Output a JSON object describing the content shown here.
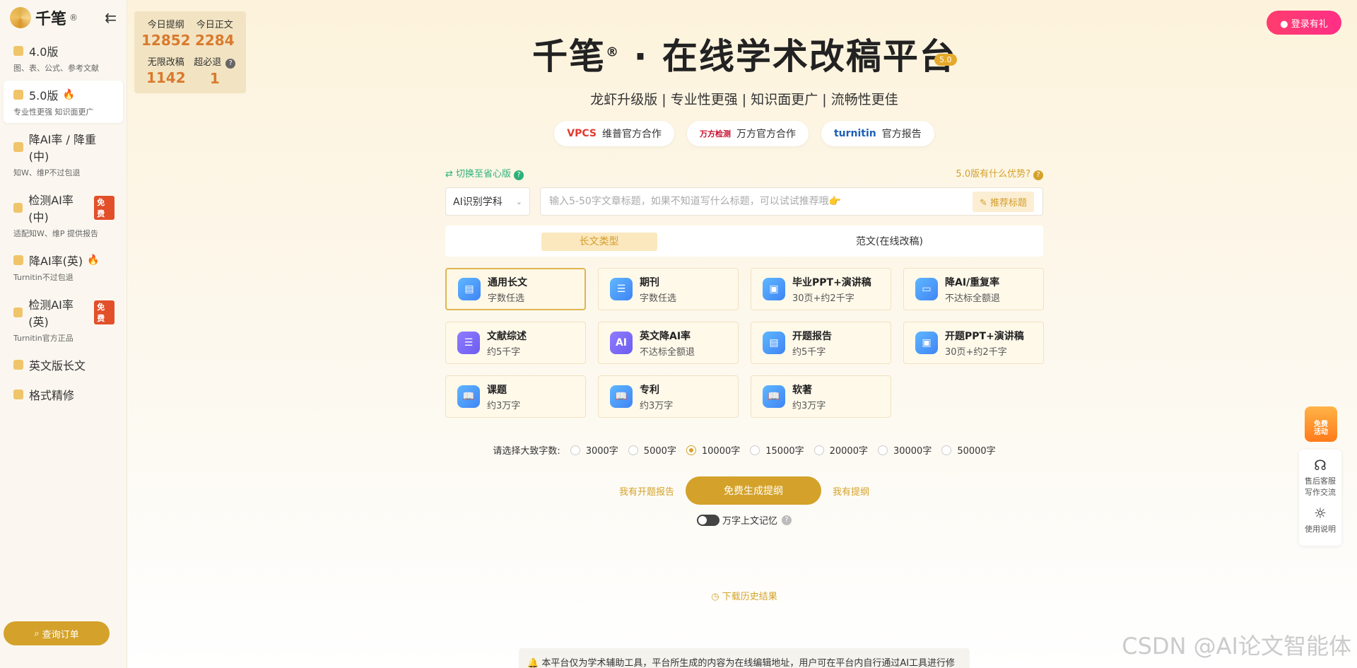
{
  "app": {
    "name": "千笔",
    "reg": "®"
  },
  "sidebar": {
    "items": [
      {
        "title": "4.0版",
        "sub": "图、表、公式、参考文献"
      },
      {
        "title": "5.0版",
        "sub": "专业性更强 知识面更广",
        "flame": "🔥"
      },
      {
        "title": "降AI率 / 降重(中)",
        "sub": "知W、维P不过包退"
      },
      {
        "title": "检测AI率(中)",
        "sub": "适配知W、维P 提供报告",
        "badge": "免费"
      },
      {
        "title": "降AI率(英)",
        "sub": "Turnitin不过包退",
        "flame": "🔥"
      },
      {
        "title": "检测AI率(英)",
        "sub": "Turnitin官方正品",
        "badge": "免费"
      },
      {
        "title": "英文版长文"
      },
      {
        "title": "格式精修"
      }
    ],
    "order_button": "查询订单"
  },
  "stats": [
    {
      "label": "今日提纲",
      "value": "12852"
    },
    {
      "label": "今日正文",
      "value": "2284"
    },
    {
      "label": "无限改稿",
      "value": "1142"
    },
    {
      "label": "超必退",
      "value": "1"
    }
  ],
  "header": {
    "title_left": "千笔",
    "title_reg": "®",
    "title_right": "· 在线学术改稿平台",
    "version_badge": "5.0",
    "subtitle": "龙虾升级版 | 专业性更强 | 知识面更广 | 流畅性更佳"
  },
  "partners": [
    {
      "logo": "VPCS",
      "label": "维普官方合作"
    },
    {
      "logo": "万方检测",
      "label": "万方官方合作"
    },
    {
      "logo": "turnitin",
      "label": "官方报告"
    }
  ],
  "toolbar": {
    "switch_label": "切换至省心版",
    "advantage_label": "5.0版有什么优势?",
    "subject_select": "AI识别学科",
    "search_placeholder": "输入5-50字文章标题，如果不知道写什么标题，可以试试推荐哦👉",
    "recommend_label": "推荐标题"
  },
  "tabs": [
    {
      "label": "长文类型"
    },
    {
      "label": "范文(在线改稿)"
    }
  ],
  "cards": [
    {
      "title": "通用长文",
      "desc": "字数任选",
      "icon": "▤"
    },
    {
      "title": "期刊",
      "desc": "字数任选",
      "icon": "☰"
    },
    {
      "title": "毕业PPT+演讲稿",
      "desc": "30页+约2千字",
      "icon": "▣"
    },
    {
      "title": "降AI/重复率",
      "desc": "不达标全额退",
      "icon": "▭"
    },
    {
      "title": "文献综述",
      "desc": "约5千字",
      "icon": "☰"
    },
    {
      "title": "英文降AI率",
      "desc": "不达标全额退",
      "icon": "AI"
    },
    {
      "title": "开题报告",
      "desc": "约5千字",
      "icon": "▤"
    },
    {
      "title": "开题PPT+演讲稿",
      "desc": "30页+约2千字",
      "icon": "▣"
    },
    {
      "title": "课题",
      "desc": "约3万字",
      "icon": "📖"
    },
    {
      "title": "专利",
      "desc": "约3万字",
      "icon": "📖"
    },
    {
      "title": "软著",
      "desc": "约3万字",
      "icon": "📖"
    }
  ],
  "word_count": {
    "label": "请选择大致字数:",
    "options": [
      "3000字",
      "5000字",
      "10000字",
      "15000字",
      "20000字",
      "30000字",
      "50000字"
    ],
    "selected": "10000字"
  },
  "actions": {
    "left_link": "我有开题报告",
    "generate": "免费生成提纲",
    "right_link": "我有提纲",
    "memory_label": "万字上文记忆"
  },
  "download_label": "下载历史结果",
  "notice": "本平台仅为学术辅助工具，平台所生成的内容为在线编辑地址，用户可在平台内自行通过AI工具进行修",
  "login_button": "登录有礼",
  "float": {
    "gift": "免费\n活动",
    "service": "售后客服\n写作交流",
    "guide": "使用说明"
  },
  "watermark": "CSDN @AI论文智能体"
}
